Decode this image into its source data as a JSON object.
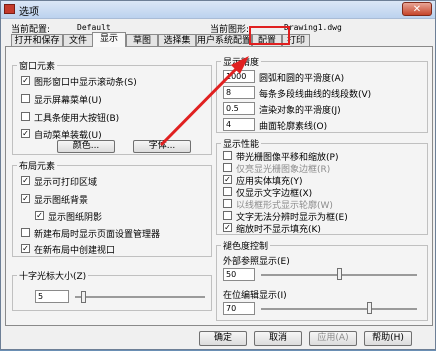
{
  "window": {
    "title": "选项",
    "close_label": "✕"
  },
  "config": {
    "current_config_label": "当前配置:",
    "current_config_value": "Default",
    "current_drawing_label": "当前图形:",
    "current_drawing_value": "Drawing1.dwg"
  },
  "tabs": [
    "打开和保存",
    "文件",
    "显示",
    "草图",
    "选择集",
    "用户系统配置",
    "配置",
    "打印"
  ],
  "window_elements": {
    "title": "窗口元素",
    "items": [
      {
        "label": "图形窗口中显示滚动条(S)",
        "checked": true
      },
      {
        "label": "显示屏幕菜单(U)",
        "checked": false
      },
      {
        "label": "工具条使用大按钮(B)",
        "checked": false
      },
      {
        "label": "自动菜单装载(U)",
        "checked": true
      }
    ],
    "color_button": "颜色...",
    "font_button": "字体..."
  },
  "layout_elements": {
    "title": "布局元素",
    "items": [
      {
        "label": "显示可打印区域",
        "checked": true
      },
      {
        "label": "显示图纸背景",
        "checked": true
      },
      {
        "label": "显示图纸阴影",
        "checked": true
      },
      {
        "label": "新建布局时显示页面设置管理器",
        "checked": false
      },
      {
        "label": "在新布局中创建视口",
        "checked": true
      }
    ]
  },
  "crosshair": {
    "title": "十字光标大小(Z)",
    "value": "5",
    "level_percent": 5
  },
  "display_precision": {
    "title": "显示精度",
    "items": [
      {
        "value": "1000",
        "label": "圆弧和圆的平滑度(A)"
      },
      {
        "value": "8",
        "label": "每条多段线曲线的线段数(V)"
      },
      {
        "value": "0.5",
        "label": "渲染对象的平滑度(J)"
      },
      {
        "value": "4",
        "label": "曲面轮廓素线(O)"
      }
    ]
  },
  "display_performance": {
    "title": "显示性能",
    "items": [
      {
        "label": "带光栅图像平移和缩放(P)",
        "checked": false,
        "disabled": false
      },
      {
        "label": "仅亮显光栅图象边框(R)",
        "checked": false,
        "disabled": true
      },
      {
        "label": "应用实体填充(Y)",
        "checked": true,
        "disabled": false
      },
      {
        "label": "仅显示文字边框(X)",
        "checked": false,
        "disabled": false
      },
      {
        "label": "以线框形式显示轮廓(W)",
        "checked": false,
        "disabled": true
      },
      {
        "label": "文字无法分辨时显示为框(E)",
        "checked": false,
        "disabled": false
      },
      {
        "label": "缩放时不显示填充(K)",
        "checked": true,
        "disabled": false
      }
    ]
  },
  "fade_control": {
    "title": "褪色度控制",
    "xref_label": "外部参照显示(E)",
    "xref_value": "50",
    "xref_level_percent": 50,
    "inplace_label": "在位编辑显示(I)",
    "inplace_value": "70",
    "inplace_level_percent": 70
  },
  "buttons": {
    "ok": "确定",
    "cancel": "取消",
    "apply": "应用(A)",
    "help": "帮助(H)"
  }
}
